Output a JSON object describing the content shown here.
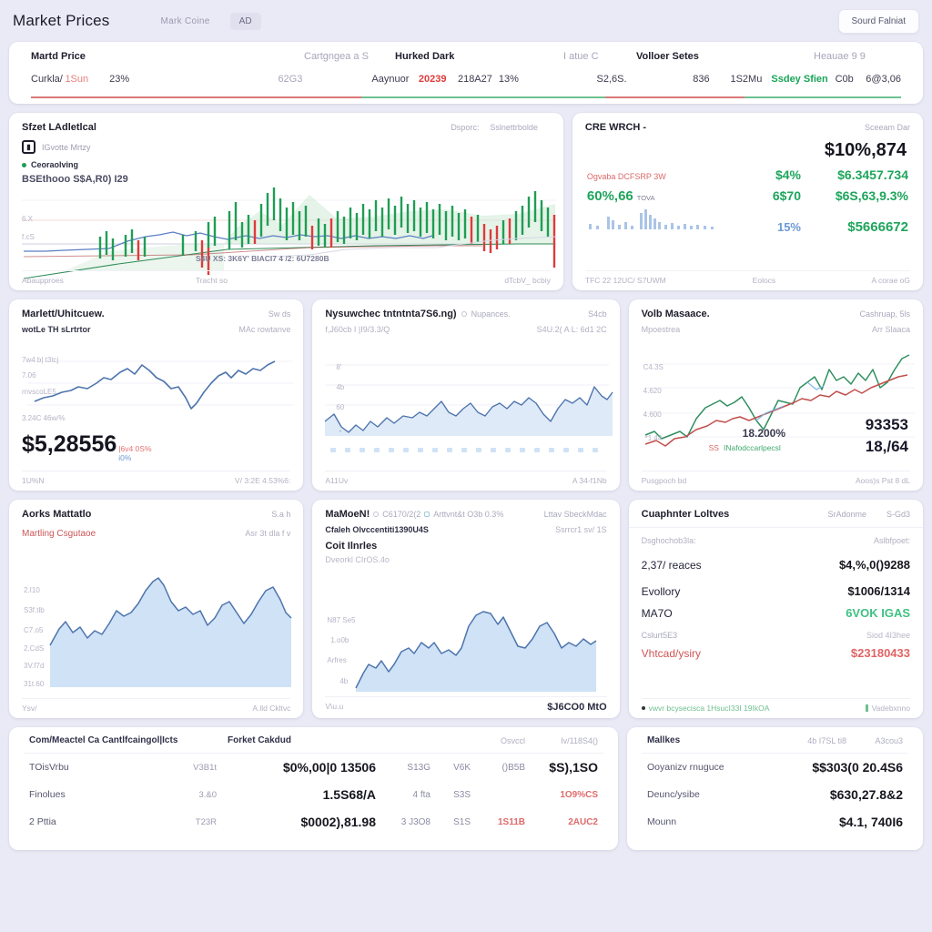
{
  "header": {
    "title": "Market Prices",
    "coin_label": "Mark Coine",
    "ad_chip": "AD",
    "search_button": "Sourd Falniat"
  },
  "summary_band": {
    "headers": [
      "Martd Price",
      "Cartgngea a S",
      "Hurked Dark",
      "I atue C",
      "Volloer Setes",
      "Heauae 9 9"
    ],
    "values": [
      {
        "text": "Curkla/",
        "style": "dark"
      },
      {
        "text": "1Sun",
        "style": "redlight"
      },
      {
        "text": "23%",
        "style": "dark"
      },
      {
        "text": "62G3",
        "style": "mute"
      },
      {
        "text": "Aaynuor",
        "style": "dark"
      },
      {
        "text": "20239",
        "style": "red"
      },
      {
        "text": "218A27",
        "style": "dark"
      },
      {
        "text": "13%",
        "style": "dark"
      },
      {
        "text": "S2,6S.",
        "style": "dark"
      },
      {
        "text": "836",
        "style": "dark"
      },
      {
        "text": "1S2Mu",
        "style": "dark"
      },
      {
        "text": "Ssdey Sfien",
        "style": "green"
      },
      {
        "text": "C0b",
        "style": "dark"
      },
      {
        "text": "6@3,06",
        "style": "dark"
      }
    ]
  },
  "hero_chart": {
    "title": "Sfzet LAdletlcal",
    "sub1": "Dsporc:",
    "sub2": "Sslnettrbolde",
    "toolbar_icon": "candlestick-icon",
    "toolbar_label": "IGvotte  Mrtzy",
    "legend_label": "Ceoraolving",
    "price_line": "BSEthooo  S$A,R0) I29",
    "y_labels": [
      "6.X",
      "f.cS"
    ],
    "overlay_note": "S4U XS: 3K6Y'    BIACI7 4 /2:   6U7280B",
    "footer_left": "Abaupproes",
    "footer_center": "Tracht so",
    "footer_right": "dTcbV_ bcbiy"
  },
  "stats_panel": {
    "title": "CRE WRCH -",
    "right_label": "Sceeam Dar",
    "headline": "$10%,874",
    "rows": [
      {
        "label": "Ogvaba DCFSRP 3W",
        "label_style": "red",
        "mid": "$4%",
        "value": "$6.3457.734"
      },
      {
        "label": "60%,66",
        "label_style": "green-big",
        "label_sup": "TOVA",
        "mid": "6$70",
        "value": "$6S,63,9.3%"
      },
      {
        "label": "",
        "label_style": "bars",
        "mid": "15%",
        "value": "$5666672"
      }
    ],
    "footer_left": "TFC 22 12UC/ S7UWM",
    "footer_center": "Eolocs",
    "footer_right": "A corae oG"
  },
  "cards_row2": [
    {
      "title": "Marlett/Uhitcuew.",
      "right": "Sw ds",
      "sub_left": "wotLe  TH  sLrtrtor",
      "sub_right": "MAc rowtanve",
      "y_labels": [
        "7w4 b| t3tcj",
        "7.06",
        "rnvscoLE5"
      ],
      "axis_note": "3.24C    46w/%",
      "big_value": "$5,28556",
      "delta_red": "|6v4 0S%",
      "delta_blue": "i0%",
      "footer_left": "1U%N",
      "footer_right": "V/ 3:2E 4.53%6:"
    },
    {
      "title": "Nysuwchec  tntntnta7S6.ng)",
      "title2": "Nupances.",
      "right": "S4cb",
      "sub_left": "f,J60cb I |I9/3.3/Q",
      "sub_right": "S4U.2( A L:  6d1 2C",
      "y_labels": [
        "8'",
        "4b",
        "60",
        "*"
      ],
      "footer_left": "A11Uv",
      "footer_right": "A  34-f1Nb"
    },
    {
      "title": "Volb Masaace.",
      "right": "Cashruap, 5ls",
      "sub_left": "Mpoestrea",
      "sub_right": "Arr Slaaca",
      "y_labels": [
        "C4.3S",
        "4.620",
        "4.600",
        "*1.44"
      ],
      "overlay_pct": "18.200%",
      "legend_red": "SS",
      "legend_green": "INafodccarlpecsl",
      "big_a": "93353",
      "big_b": "18,/64",
      "footer_left": "Pusgpoch bd",
      "footer_right": "Aoos)s Pst 8 dL"
    }
  ],
  "cards_row3": [
    {
      "title": "Aorks Mattatlo",
      "right": "S.a h",
      "sub_left": "Martling Csgutaoe",
      "sub_right": "Asr 3t dla f  v",
      "y_labels": [
        "2.I10",
        "S3f.tlb",
        "C7.o5",
        "2.CdS",
        "3V.f7d",
        "31t.60"
      ],
      "footer_left": "Ysv/",
      "footer_right": "A.lld Ckltvc"
    },
    {
      "title": "MaMoeN!",
      "title_chip1": "C6170/2(2",
      "title_chip2": "Arttvnt&t O3b  0.3%",
      "right": "Lttav  SbeckMdac",
      "sub_left": "Cfaleh Olvccentiti1390U4S",
      "sub_right": "Ssrrcr1 sv/ 1S",
      "sub2": "Coit Ilnrles",
      "sub3": "Dveorkl  CIrOS.4o",
      "y_labels": [
        "N87 Se5",
        "1.o0b",
        "Arfres",
        "4b"
      ],
      "footer_left": "V\\u.u",
      "footer_right": "$J6CO0 MtO"
    },
    {
      "title": "Cuaphnter Loltves",
      "right1": "SrAdonme",
      "right2": "S-Gd3",
      "sub_left": "Dsghochob3la:",
      "sub_right": "Aslbfpoet:",
      "rows": [
        {
          "k": "2,37/ reaces",
          "v": "$4,%,0()9288",
          "v_style": "dark",
          "k_style": "dark"
        },
        {
          "k": "Evollory",
          "v": "$1006/1314",
          "v_style": "dark",
          "k_style": "dark"
        },
        {
          "k": "MA7O",
          "v": "6VOK IGAS",
          "v_style": "green",
          "k_style": "dark"
        },
        {
          "k": "Cslurt5E3",
          "v": "Siod  4I3hee",
          "v_style": "small",
          "k_style": "small"
        },
        {
          "k": "Vhtcad/ysiry",
          "v": "$23180433",
          "v_style": "red",
          "k_style": "red"
        }
      ],
      "footer_left_dot": "vwvr bcysecisca 1HsucI33I 19IkOA",
      "footer_right": "Vadebxnno"
    }
  ],
  "bottom_tables": [
    {
      "headers": [
        "Com/Meactel Ca Cantlfcaingol|Icts",
        "Forket Cakdud",
        "Osvccl",
        "Iv/118S4()"
      ],
      "rows": [
        {
          "label": "TOisVrbu",
          "mini": "V3B1t",
          "value": "$0%,00|0 13506",
          "c1": "S13G",
          "c2": "V6K",
          "c3": "()B5B",
          "c4": "$S),1SO",
          "c4_style": "dark"
        },
        {
          "label": "Finolues",
          "mini": "3.&0",
          "value": "1.5S68/A",
          "c1": "4 fta",
          "c2": "S3S",
          "c3": "",
          "c4": "1O9%CS",
          "c4_style": "red"
        },
        {
          "label": "2 Pttia",
          "mini": "T23R",
          "value": "$0002),81.98",
          "c1": "3 J3O8",
          "c2": "S1S",
          "c3": "1S11B",
          "c3_style": "red",
          "c4": "2AUC2",
          "c4_style": "red"
        }
      ]
    },
    {
      "headers": [
        "Mallkes",
        "4b I7SL ti8",
        "A3cou3"
      ],
      "rows": [
        {
          "label": "Ooyanizv rnuguce",
          "value": "$$303(0 20.4S6"
        },
        {
          "label": "Deunc/ysibe",
          "value": "$630,27.8&2"
        },
        {
          "label": "Mounn",
          "value": "$4.1, 740I6"
        }
      ]
    }
  ],
  "colors": {
    "page_bg": "#eaeaf6",
    "card_bg": "#ffffff",
    "green": "#1ea55c",
    "red": "#e03b3b",
    "blue_line": "#4a6fa5",
    "blue_fill": "#cfe2f6"
  }
}
